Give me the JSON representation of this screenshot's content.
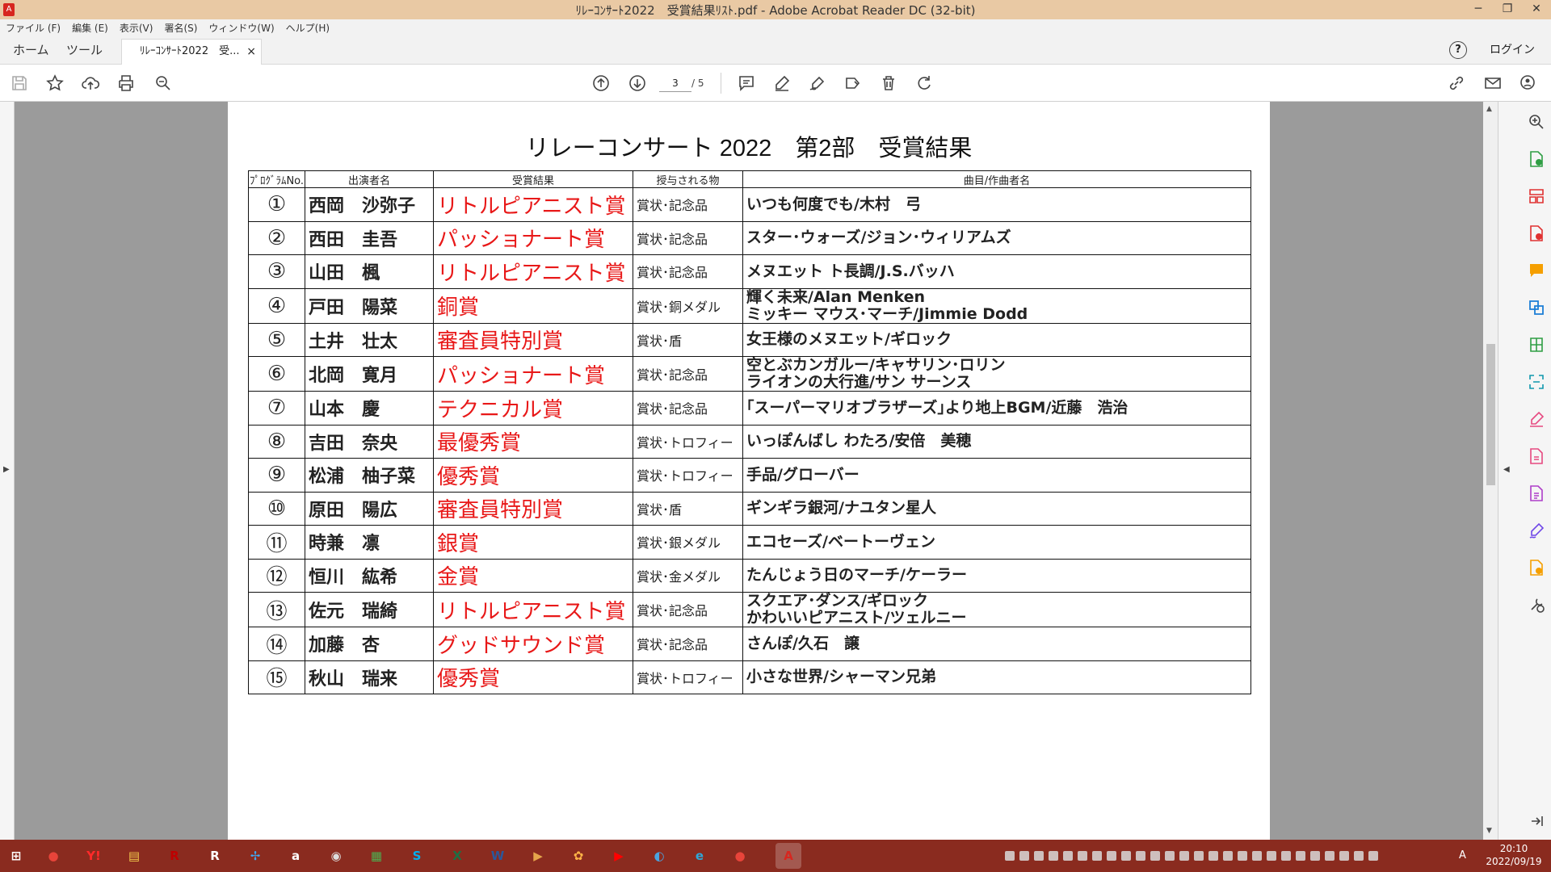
{
  "window": {
    "title": "ﾘﾚｰｺﾝｻｰﾄ2022　受賞結果ﾘｽﾄ.pdf - Adobe Acrobat Reader DC (32-bit)",
    "minimize": "─",
    "restore": "❐",
    "close": "✕"
  },
  "menu": [
    "ファイル (F)",
    "編集 (E)",
    "表示(V)",
    "署名(S)",
    "ウィンドウ(W)",
    "ヘルプ(H)"
  ],
  "tabs": {
    "home": "ホーム",
    "tools": "ツール",
    "document": "ﾘﾚｰｺﾝｻｰﾄ2022　受...",
    "close": "×",
    "help": "?",
    "login": "ログイン"
  },
  "toolbar": {
    "current_page": "3",
    "total_pages": "/ 5"
  },
  "document": {
    "title": "リレーコンサート 2022　第2部　受賞結果",
    "headers": [
      "ﾌﾟﾛｸﾞﾗﾑNo.",
      "出演者名",
      "受賞結果",
      "授与される物",
      "曲目/作曲者名"
    ],
    "rows": [
      {
        "no": "①",
        "performer": "西岡　沙弥子",
        "award": "リトルピアニスト賞",
        "prize": "賞状･記念品",
        "pieces": [
          "いつも何度でも/木村　弓"
        ]
      },
      {
        "no": "②",
        "performer": "西田　圭吾",
        "award": "パッショナート賞",
        "prize": "賞状･記念品",
        "pieces": [
          "スター･ウォーズ/ジョン･ウィリアムズ"
        ]
      },
      {
        "no": "③",
        "performer": "山田　楓",
        "award": "リトルピアニスト賞",
        "prize": "賞状･記念品",
        "pieces": [
          "メヌエット ト長調/J.S.バッハ"
        ]
      },
      {
        "no": "④",
        "performer": "戸田　陽菜",
        "award": "銅賞",
        "prize": "賞状･銅メダル",
        "pieces": [
          "輝く未来/Alan Menken",
          "ミッキー マウス･マーチ/Jimmie Dodd"
        ]
      },
      {
        "no": "⑤",
        "performer": "土井　壮太",
        "award": "審査員特別賞",
        "prize": "賞状･盾",
        "pieces": [
          "女王様のメヌエット/ギロック"
        ]
      },
      {
        "no": "⑥",
        "performer": "北岡　寛月",
        "award": "パッショナート賞",
        "prize": "賞状･記念品",
        "pieces": [
          "空とぶカンガルー/キャサリン･ロリン",
          "ライオンの大行進/サン サーンス"
        ]
      },
      {
        "no": "⑦",
        "performer": "山本　慶",
        "award": "テクニカル賞",
        "prize": "賞状･記念品",
        "pieces": [
          "｢スーパーマリオブラザーズ｣より地上BGM/近藤　浩治"
        ]
      },
      {
        "no": "⑧",
        "performer": "吉田　奈央",
        "award": "最優秀賞",
        "prize": "賞状･トロフィー",
        "pieces": [
          "いっぽんばし わたろ/安倍　美穂"
        ]
      },
      {
        "no": "⑨",
        "performer": "松浦　柚子菜",
        "award": "優秀賞",
        "prize": "賞状･トロフィー",
        "pieces": [
          "手品/グローバー"
        ]
      },
      {
        "no": "⑩",
        "performer": "原田　陽広",
        "award": "審査員特別賞",
        "prize": "賞状･盾",
        "pieces": [
          "ギンギラ銀河/ナユタン星人"
        ]
      },
      {
        "no": "⑪",
        "performer": "時兼　凛",
        "award": "銀賞",
        "prize": "賞状･銀メダル",
        "pieces": [
          "エコセーズ/ベートーヴェン"
        ]
      },
      {
        "no": "⑫",
        "performer": "恒川　紘希",
        "award": "金賞",
        "prize": "賞状･金メダル",
        "pieces": [
          "たんじょう日のマーチ/ケーラー"
        ]
      },
      {
        "no": "⑬",
        "performer": "佐元　瑞綺",
        "award": "リトルピアニスト賞",
        "prize": "賞状･記念品",
        "pieces": [
          "スクエア･ダンス/ギロック",
          "かわいいピアニスト/ツェルニー"
        ]
      },
      {
        "no": "⑭",
        "performer": "加藤　杏",
        "award": "グッドサウンド賞",
        "prize": "賞状･記念品",
        "pieces": [
          "さんぽ/久石　譲"
        ]
      },
      {
        "no": "⑮",
        "performer": "秋山　瑞来",
        "award": "優秀賞",
        "prize": "賞状･トロフィー",
        "pieces": [
          "小さな世界/シャーマン兄弟"
        ]
      }
    ]
  },
  "taskbar": {
    "apps": [
      {
        "name": "start",
        "label": "⊞",
        "color": "#ffffff"
      },
      {
        "name": "chrome",
        "label": "●",
        "color": "#e8443a"
      },
      {
        "name": "yahoo",
        "label": "Y!",
        "color": "#ff2a2a"
      },
      {
        "name": "explorer",
        "label": "▤",
        "color": "#f2c94c"
      },
      {
        "name": "rakuten-r",
        "label": "R",
        "color": "#bf0000"
      },
      {
        "name": "rakuten",
        "label": "R",
        "color": "#ffffff"
      },
      {
        "name": "fan",
        "label": "✢",
        "color": "#3fa9f5"
      },
      {
        "name": "amazon",
        "label": "a",
        "color": "#ffffff"
      },
      {
        "name": "eye",
        "label": "◉",
        "color": "#dddddd"
      },
      {
        "name": "store",
        "label": "▦",
        "color": "#4caf50"
      },
      {
        "name": "skype",
        "label": "S",
        "color": "#00aff0"
      },
      {
        "name": "excel",
        "label": "X",
        "color": "#1d7044"
      },
      {
        "name": "word",
        "label": "W",
        "color": "#2b579a"
      },
      {
        "name": "video",
        "label": "▶",
        "color": "#e5a54b"
      },
      {
        "name": "flower",
        "label": "✿",
        "color": "#ffb347"
      },
      {
        "name": "youtube",
        "label": "▶",
        "color": "#ff0000"
      },
      {
        "name": "globe",
        "label": "◐",
        "color": "#4aa3df"
      },
      {
        "name": "edge",
        "label": "e",
        "color": "#2fa7d7"
      },
      {
        "name": "chrome-2",
        "label": "●",
        "color": "#e8443a"
      },
      {
        "name": "acrobat",
        "label": "A",
        "color": "#d7261f"
      }
    ],
    "ime": "A",
    "time": "20:10",
    "date": "2022/09/19"
  }
}
